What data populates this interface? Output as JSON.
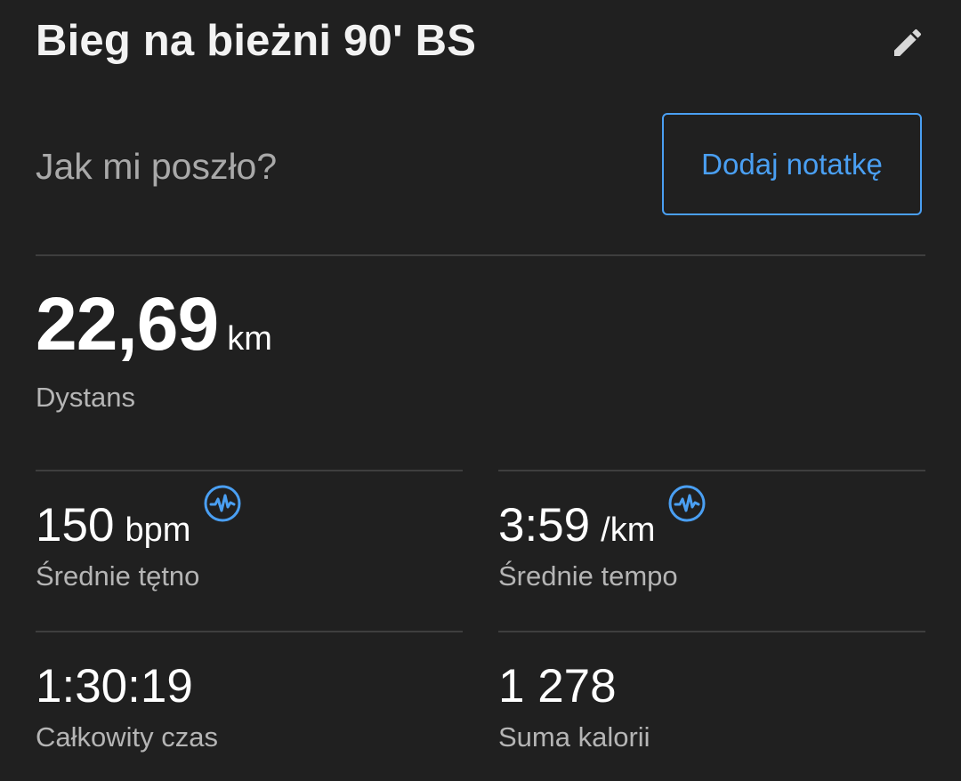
{
  "header": {
    "title": "Bieg na bieżni 90' BS",
    "edit_icon": "pencil-icon"
  },
  "notes": {
    "prompt": "Jak mi poszło?",
    "add_note_label": "Dodaj notatkę"
  },
  "distance": {
    "value": "22,69",
    "unit": "km",
    "label": "Dystans"
  },
  "stats": {
    "avg_hr": {
      "value": "150",
      "unit": "bpm",
      "label": "Średnie tętno",
      "icon": "heart-rate-sensor-icon"
    },
    "avg_pace": {
      "value": "3:59",
      "unit": "/km",
      "label": "Średnie tempo",
      "icon": "heart-rate-sensor-icon"
    },
    "total_time": {
      "value": "1:30:19",
      "label": "Całkowity czas"
    },
    "total_calories": {
      "value": "1 278",
      "label": "Suma kalorii"
    }
  },
  "colors": {
    "background": "#202020",
    "accent": "#4a9ff2",
    "divider": "#3e3e3e",
    "secondary_text": "#b5b5b5"
  }
}
